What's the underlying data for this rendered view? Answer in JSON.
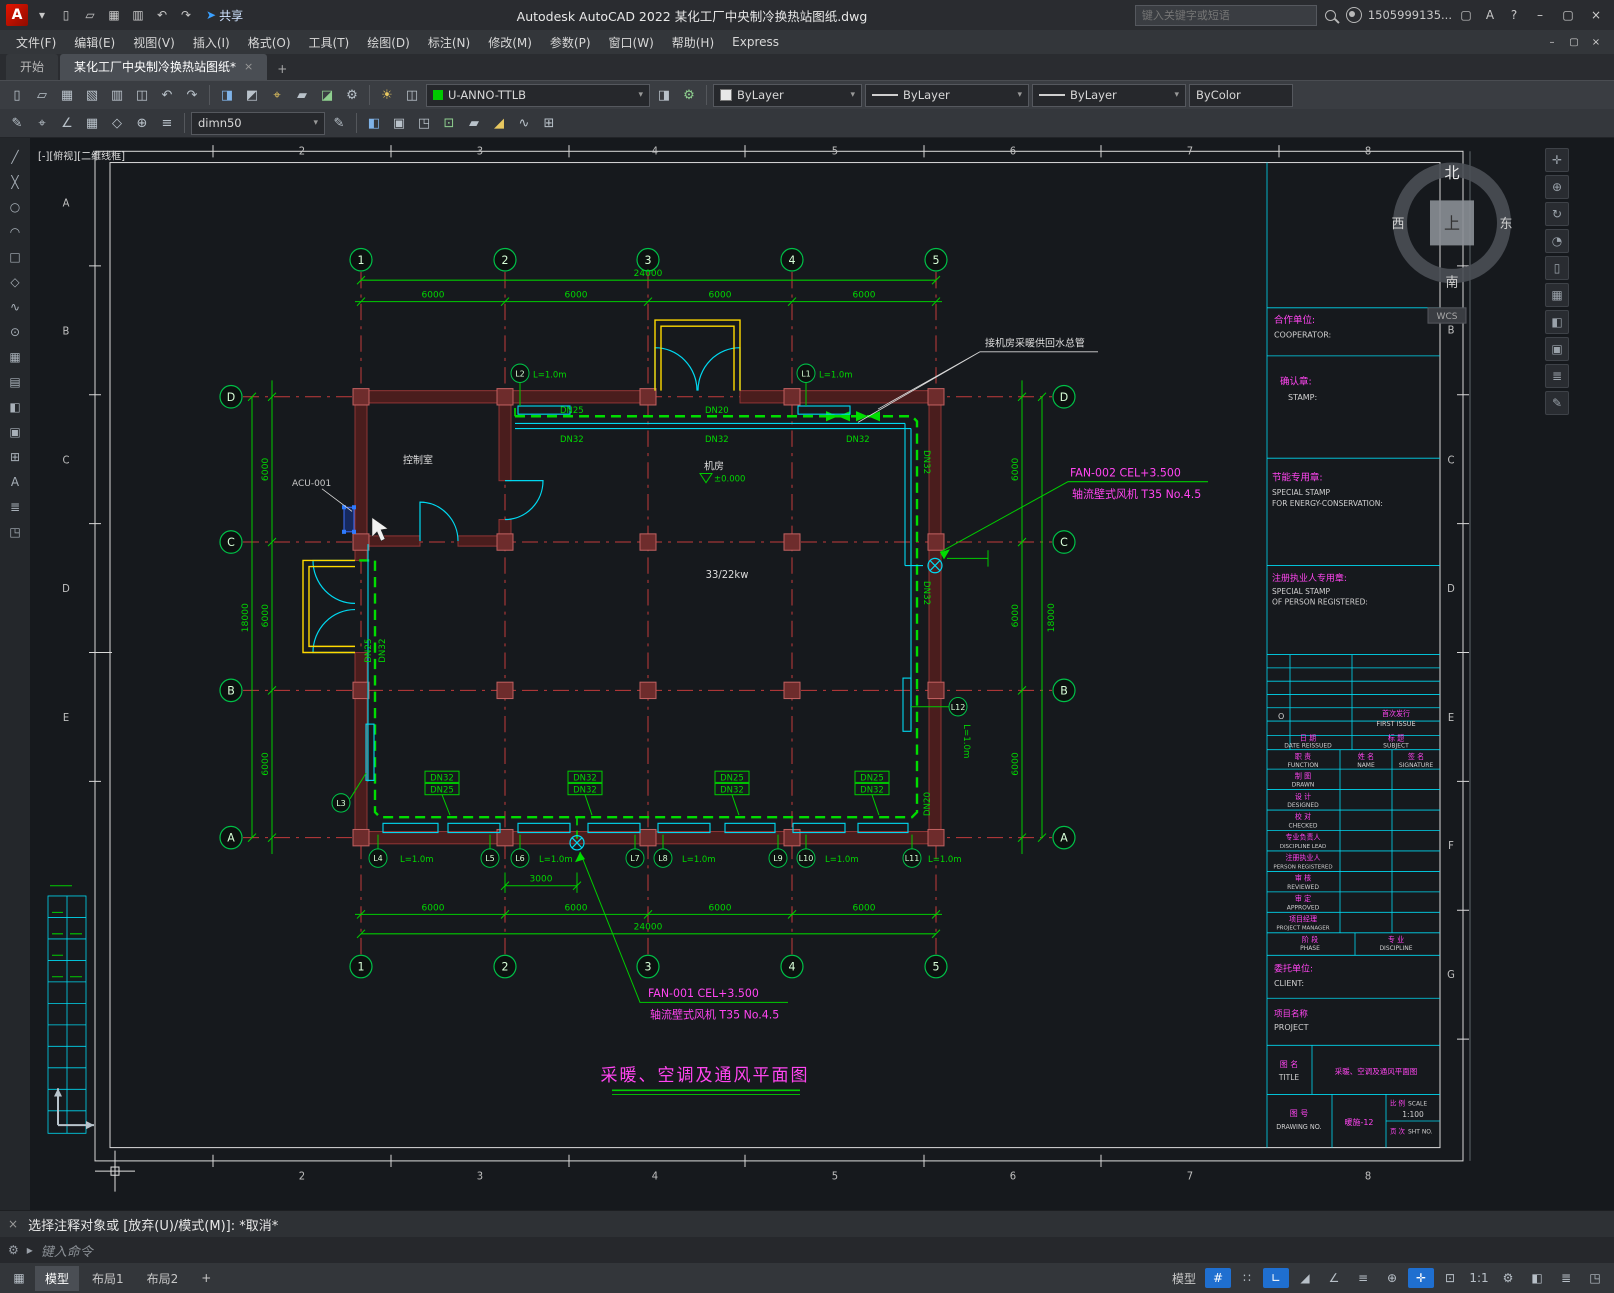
{
  "titlebar": {
    "logo": "A",
    "share": "共享",
    "app_title": "Autodesk AutoCAD 2022   某化工厂中央制冷换热站图纸.dwg",
    "search_placeholder": "键入关键字或短语",
    "user": "1505999135..."
  },
  "win": {
    "min": "–",
    "max": "▢",
    "close": "×"
  },
  "menubar": {
    "items": [
      "文件(F)",
      "编辑(E)",
      "视图(V)",
      "插入(I)",
      "格式(O)",
      "工具(T)",
      "绘图(D)",
      "标注(N)",
      "修改(M)",
      "参数(P)",
      "窗口(W)",
      "帮助(H)",
      "Express"
    ]
  },
  "tabs": {
    "start": "开始",
    "doc": "某化工厂中央制冷换热站图纸*",
    "close": "×",
    "add": "+"
  },
  "ribbon": {
    "layer": "U-ANNO-TTLB",
    "color": "ByLayer",
    "linetype": "ByLayer",
    "lineweight": "ByLayer",
    "plotstyle": "ByColor",
    "dimstyle": "dimn50",
    "arrow": "▾"
  },
  "ic": {
    "qat": [
      "▯",
      "▱",
      "▦",
      "▥",
      "↶",
      "↷"
    ],
    "r1a": [
      "▯",
      "▱",
      "▦",
      "▧",
      "▥",
      "◫",
      "↶",
      "↷",
      "◨",
      "◩"
    ],
    "r1b": [
      "⌖",
      "▰",
      "◪",
      "⚙"
    ],
    "r1c": [
      "☀",
      "◫",
      "◨"
    ],
    "r2": [
      "✎",
      "⌖",
      "∠",
      "▦",
      "◇",
      "⊕",
      "≡",
      "◧",
      "▣",
      "◳",
      "⊡",
      "▰",
      "◢",
      "∿",
      "⊞",
      "✎"
    ],
    "left": [
      "╱",
      "╳",
      "○",
      "◠",
      "□",
      "◇",
      "∿",
      "⊙",
      "▦",
      "▤",
      "◧",
      "▣",
      "⊞",
      "A",
      "≣",
      "◳"
    ],
    "right": [
      "✛",
      "⊕",
      "↻",
      "◔",
      "▯",
      "▦",
      "◧",
      "▣",
      "≣",
      "✎"
    ],
    "status": [
      "▦",
      "#",
      "∷",
      "∟",
      "◢",
      "∠",
      "≡",
      "⊕",
      "✛",
      "⊡",
      "◧",
      "≣",
      "◳"
    ],
    "gear": "⚙",
    "caret": "▸",
    "close": "×"
  },
  "canvas": {
    "viewport_controls": "[-][俯视][二维线框]",
    "wcs": "WCS",
    "compass": {
      "n": "北",
      "s": "南",
      "w": "西",
      "e": "东",
      "up": "上"
    }
  },
  "sheet": {
    "top_nums": [
      "2",
      "3",
      "4",
      "5",
      "6",
      "7",
      "8"
    ],
    "bottom_nums": [
      "2",
      "3",
      "4",
      "5",
      "6",
      "7",
      "8"
    ],
    "left_letters": [
      "A",
      "B",
      "C",
      "D",
      "E"
    ],
    "right_letters": [
      "B",
      "C",
      "D",
      "E",
      "F",
      "G"
    ]
  },
  "plan": {
    "cols": [
      "1",
      "2",
      "3",
      "4",
      "5"
    ],
    "rows": [
      "D",
      "C",
      "B",
      "A"
    ],
    "d6000": "6000",
    "d24000": "24000",
    "d18000": "18000",
    "d3000": "3000",
    "control_room": "控制室",
    "machine_room": "机房",
    "level": "±0.000",
    "power": "33/22kw",
    "acu": "ACU-001",
    "pipe_note": "接机房采暖供回水总管",
    "fan2_1": "FAN-002 CEL+3.500",
    "fan2_2": "轴流壁式风机 T35 No.4.5",
    "fan1_1": "FAN-001 CEL+3.500",
    "fan1_2": "轴流壁式风机 T35 No.4.5",
    "title": "采暖、空调及通风平面图",
    "dn25": "DN25",
    "dn32": "DN32",
    "dn20": "DN20",
    "llen": "L=1.0m",
    "tags": [
      "L1",
      "L2",
      "L3",
      "L4",
      "L5",
      "L6",
      "L7",
      "L8",
      "L9",
      "L10",
      "L11",
      "L12"
    ]
  },
  "titleblock": {
    "coop_cn": "合作单位:",
    "coop_en": "COOPERATOR:",
    "stamp_cn": "确认章:",
    "stamp_en": "STAMP:",
    "energy_cn": "节能专用章:",
    "energy_en1": "SPECIAL STAMP",
    "energy_en2": "FOR ENERGY-CONSERVATION:",
    "reg_cn": "注册执业人专用章:",
    "reg_en1": "SPECIAL STAMP",
    "reg_en2": "OF PERSON REGISTERED:",
    "o": "O",
    "first_cn": "首次发行",
    "first_en": "FIRST ISSUE",
    "date_cn": "日 期",
    "date_en": "DATE REISSUED",
    "subj_cn": "标 题",
    "subj_en": "SUBJECT",
    "func_cn": "职 责",
    "func_en": "FUNCTION",
    "name_cn": "姓 名",
    "name_en": "NAME",
    "sig_cn": "签 名",
    "sig_en": "SIGNATURE",
    "r1_cn": "制 图",
    "r1_en": "DRAWN",
    "r2_cn": "设 计",
    "r2_en": "DESIGNED",
    "r3_cn": "校 对",
    "r3_en": "CHECKED",
    "r4_cn": "专业负责人",
    "r4_en": "DISCIPLINE LEAD",
    "r5_cn": "注册执业人",
    "r5_en": "PERSON REGISTERED",
    "r6_cn": "审 核",
    "r6_en": "REVIEWED",
    "r7_cn": "审 定",
    "r7_en": "APPROVED",
    "r8_cn": "项目经理",
    "r8_en": "PROJECT MANAGER",
    "phase_cn": "阶 段",
    "phase_en": "PHASE",
    "disc_cn": "专 业",
    "disc_en": "DISCIPLINE",
    "client_cn": "委托单位:",
    "client_en": "CLIENT:",
    "project_cn": "项目名称",
    "project_en": "PROJECT",
    "title_cn": "图 名",
    "title_en": "TITLE",
    "title_val": "采暖、空调及通风平面图",
    "no_cn": "图 号",
    "no_en": "DRAWING NO.",
    "no_val": "暖施-12",
    "scale_cn": "比 例",
    "scale_en": "SCALE",
    "scale_val": "1:100",
    "sht_cn": "页 次",
    "sht_en": "SHT NO."
  },
  "cmd": {
    "line1": "选择注释对象或 [放弃(U)/模式(M)]: *取消*",
    "prompt": "键入命令"
  },
  "statusbar": {
    "tab_model": "模型",
    "tab_layout1": "布局1",
    "tab_layout2": "布局2",
    "add": "+",
    "model_btn": "模型",
    "scale": "1:1"
  }
}
